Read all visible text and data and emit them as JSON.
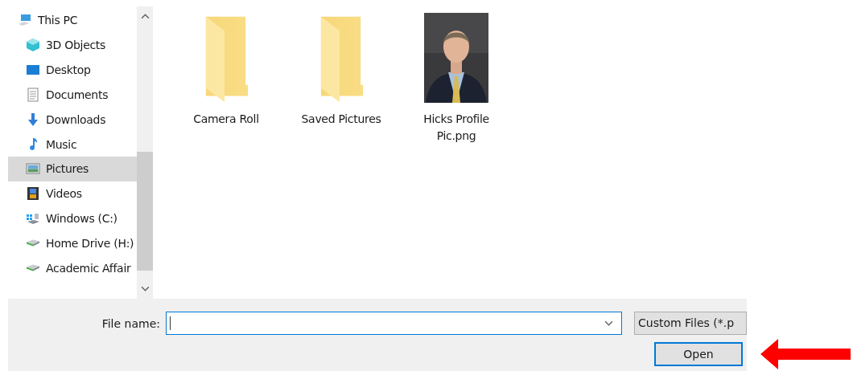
{
  "navigation": {
    "items": [
      {
        "label": "This PC",
        "kind": "computer",
        "selected": false,
        "children": [
          {
            "label": "3D Objects",
            "kind": "cube",
            "selected": false
          },
          {
            "label": "Desktop",
            "kind": "desktop",
            "selected": false
          },
          {
            "label": "Documents",
            "kind": "document",
            "selected": false
          },
          {
            "label": "Downloads",
            "kind": "download",
            "selected": false
          },
          {
            "label": "Music",
            "kind": "music",
            "selected": false
          },
          {
            "label": "Pictures",
            "kind": "pictures",
            "selected": true
          },
          {
            "label": "Videos",
            "kind": "videos",
            "selected": false
          },
          {
            "label": "Windows (C:)",
            "kind": "system-drive",
            "selected": false
          },
          {
            "label": "Home Drive (H:)",
            "kind": "drive",
            "selected": false
          },
          {
            "label": "Academic Affair",
            "kind": "drive",
            "selected": false
          }
        ]
      }
    ]
  },
  "files": [
    {
      "name": "Camera Roll",
      "kind": "folder"
    },
    {
      "name": "Saved Pictures",
      "kind": "folder"
    },
    {
      "name": "Hicks Profile Pic.png",
      "kind": "picture"
    }
  ],
  "file_name": {
    "label": "File name:"
  },
  "file_type": {
    "value": "Custom Files (*.p"
  },
  "buttons": [
    {
      "label": "Open"
    }
  ]
}
